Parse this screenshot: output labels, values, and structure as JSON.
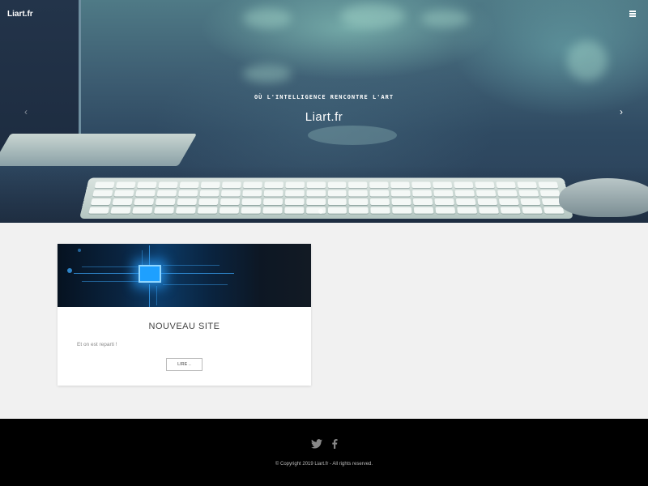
{
  "header": {
    "brand": "Liart.fr",
    "menu_icon": "hamburger-menu-icon"
  },
  "hero": {
    "tagline": "OÙ L'INTELLIGENCE RENCONTRE L'ART",
    "title": "Liart.fr",
    "prev_icon": "chevron-left-icon",
    "next_icon": "chevron-right-icon",
    "prev_glyph": "‹",
    "next_glyph": "›"
  },
  "posts": [
    {
      "title": "NOUVEAU SITE",
      "excerpt": "Et on est reparti !",
      "button": "LIRE ..",
      "image": "circuit-chip-image"
    }
  ],
  "footer": {
    "social": [
      "twitter-icon",
      "facebook-icon"
    ],
    "copyright": "© Copyright 2019 Liart.fr - All rights reserved."
  }
}
